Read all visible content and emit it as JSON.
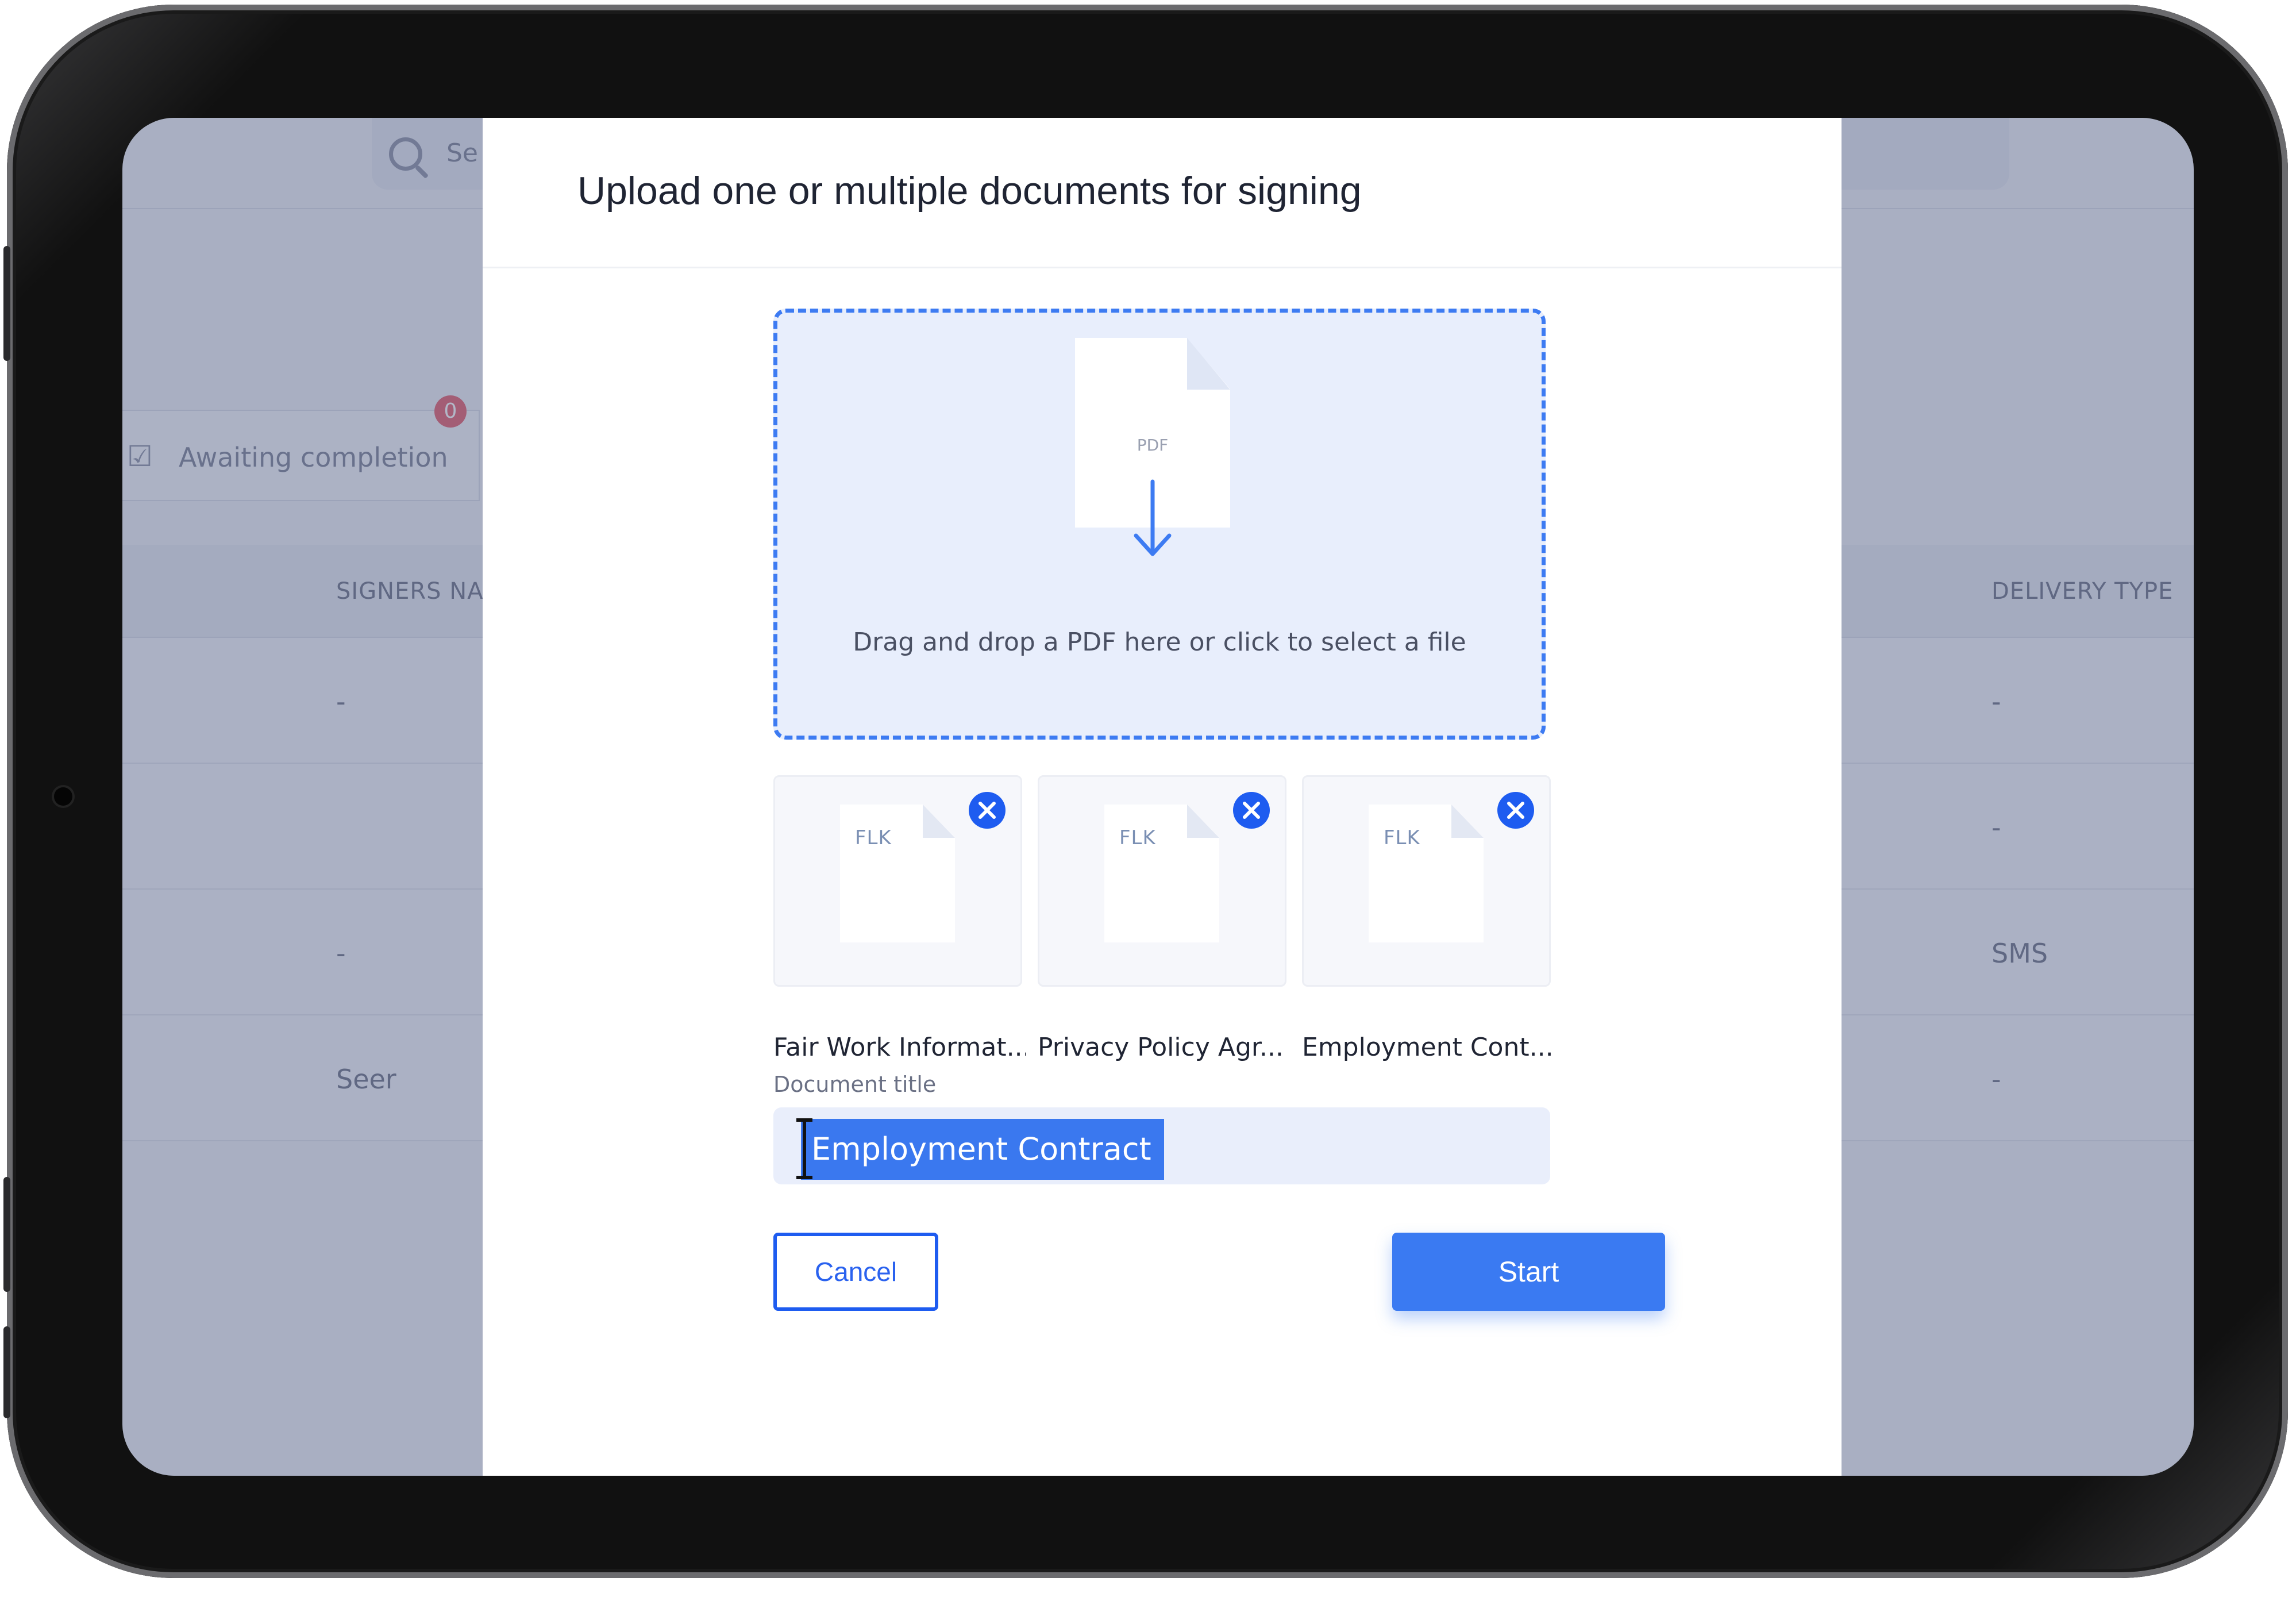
{
  "background": {
    "search_placeholder": "Se",
    "tab_label": "Awaiting completion",
    "tab_badge": "0",
    "col_signers": "SIGNERS NA",
    "col_delivery": "DELIVERY TYPE",
    "rows": [
      {
        "signer": "-",
        "delivery": "-"
      },
      {
        "signer": "",
        "delivery": "-"
      },
      {
        "signer": "-",
        "delivery": "SMS"
      },
      {
        "signer": "Seer",
        "delivery": "-"
      }
    ]
  },
  "modal": {
    "title": "Upload one or multiple documents for signing",
    "dropzone": {
      "file_label": "PDF",
      "instruction": "Drag and drop a PDF here or click to select a file"
    },
    "files": [
      {
        "icon_label": "FLK",
        "name": "Fair Work Informat..."
      },
      {
        "icon_label": "FLK",
        "name": "Privacy Policy Agr..."
      },
      {
        "icon_label": "FLK",
        "name": "Employment Cont..."
      }
    ],
    "document_title_label": "Document title",
    "document_title_value": "Employment Contract",
    "cancel_label": "Cancel",
    "start_label": "Start"
  },
  "colors": {
    "accent": "#3a7af2",
    "remove_button": "#1e5cf0",
    "dropzone_border": "#3d7bf2"
  }
}
